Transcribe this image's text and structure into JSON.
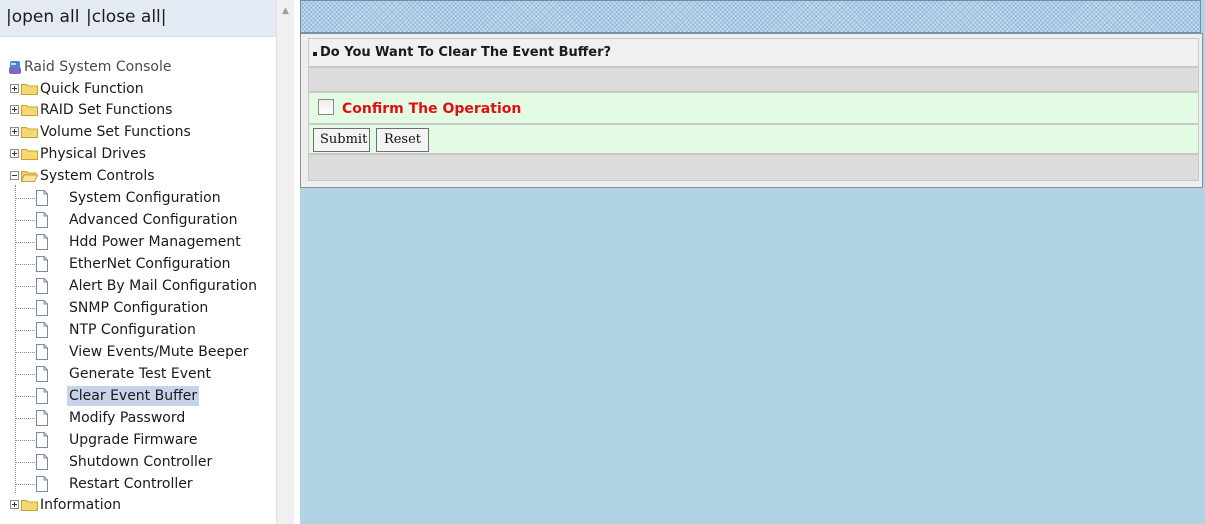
{
  "tree_header": {
    "open_all": "|open all",
    "close_all": "|close all|"
  },
  "tree": {
    "root_label": "Raid System Console",
    "folders": [
      {
        "label": "Quick Function",
        "expanded": false
      },
      {
        "label": "RAID Set Functions",
        "expanded": false
      },
      {
        "label": "Volume Set Functions",
        "expanded": false
      },
      {
        "label": "Physical Drives",
        "expanded": false
      },
      {
        "label": "System Controls",
        "expanded": true
      },
      {
        "label": "Information",
        "expanded": false
      }
    ],
    "system_controls_items": [
      "System Configuration",
      "Advanced Configuration",
      "Hdd Power Management",
      "EtherNet Configuration",
      "Alert By Mail Configuration",
      "SNMP Configuration",
      "NTP Configuration",
      "View Events/Mute Beeper",
      "Generate Test Event",
      "Clear Event Buffer",
      "Modify Password",
      "Upgrade Firmware",
      "Shutdown Controller",
      "Restart Controller"
    ],
    "selected_item": "Clear Event Buffer"
  },
  "form": {
    "title": "Do You Want To Clear The Event Buffer?",
    "confirm_label": "Confirm The Operation",
    "confirm_checked": false,
    "submit_label": "Submit",
    "reset_label": "Reset"
  },
  "icons": {
    "root": "raid-console-icon",
    "folder": "folder-icon",
    "page": "page-icon",
    "expander": "expander-icon"
  },
  "colors": {
    "content_background": "#b0d4e6",
    "confirm_label": "#e01010",
    "confirm_row": "#e3fae3",
    "selected_item": "#c6d3e8"
  }
}
